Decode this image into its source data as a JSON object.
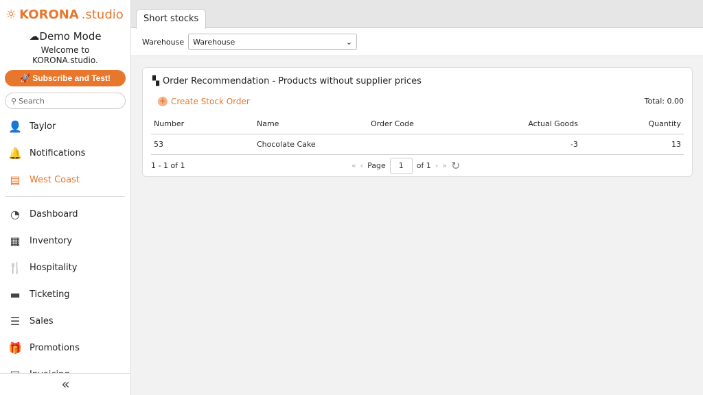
{
  "sidebar": {
    "logo": "KORONA",
    "logo_suffix": ".studio",
    "mode": "Demo Mode",
    "welcome_line1": "Welcome to",
    "welcome_line2": "KORONA.studio.",
    "subscribe": "Subscribe and Test!",
    "search_placeholder": "Search",
    "items": [
      {
        "label": "Taylor",
        "icon": "user-icon"
      },
      {
        "label": "Notifications",
        "icon": "bell-icon"
      },
      {
        "label": "West Coast",
        "icon": "store-icon"
      },
      {
        "label": "Dashboard",
        "icon": "gauge-icon"
      },
      {
        "label": "Inventory",
        "icon": "boxes-icon"
      },
      {
        "label": "Hospitality",
        "icon": "cutlery-icon"
      },
      {
        "label": "Ticketing",
        "icon": "ticket-icon"
      },
      {
        "label": "Sales",
        "icon": "receipt-icon"
      },
      {
        "label": "Promotions",
        "icon": "gift-icon"
      },
      {
        "label": "Invoicing",
        "icon": "invoice-icon"
      }
    ]
  },
  "tab": "Short stocks",
  "filter": {
    "label": "Warehouse",
    "value": "Warehouse"
  },
  "panel": {
    "title": "Order Recommendation - Products without supplier prices",
    "create": "Create Stock Order",
    "total": "Total: 0.00",
    "columns": [
      "Number",
      "Name",
      "Order Code",
      "Actual Goods",
      "Quantity"
    ],
    "rows": [
      [
        "53",
        "Chocolate Cake",
        "",
        "-3",
        "13"
      ]
    ],
    "range": "1 - 1 of 1",
    "page_label": "Page",
    "page": "1",
    "of": "of 1"
  },
  "colors": {
    "accent": "#e8772e"
  }
}
